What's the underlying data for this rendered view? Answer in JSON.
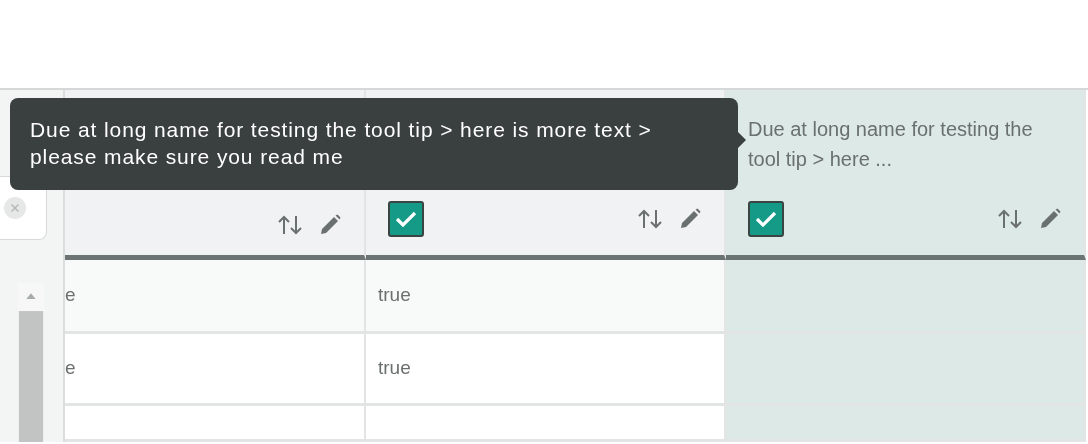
{
  "tooltip": {
    "text": "Due at long name for testing the tool tip > here is more text > please make sure you read me"
  },
  "columns": [
    {
      "kind": "plain",
      "selected": false
    },
    {
      "kind": "checkbox",
      "checked": true,
      "selected": false
    },
    {
      "kind": "checkbox",
      "title": "Due at long name for testing the tool tip > here ...",
      "checked": true,
      "selected": true
    }
  ],
  "rows": [
    {
      "column_1": "e",
      "column_2": "true"
    },
    {
      "column_1": "e",
      "column_2": "true"
    }
  ]
}
